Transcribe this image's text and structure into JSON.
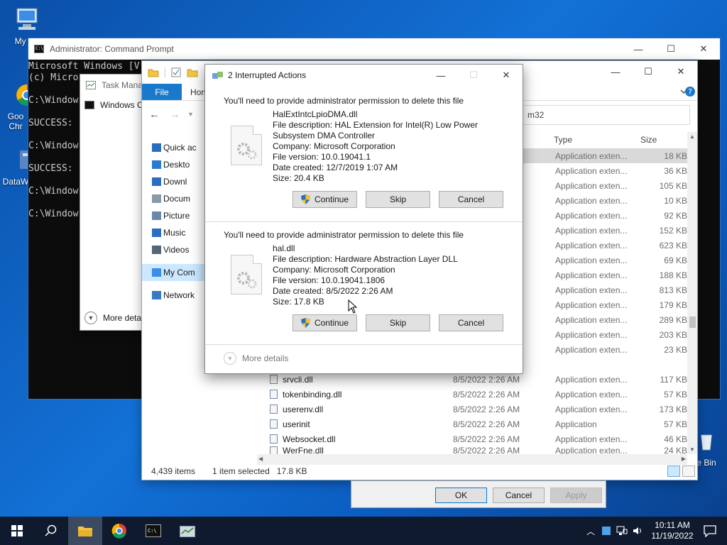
{
  "desktop": {
    "icons": [
      {
        "label": "My Co"
      },
      {
        "label": "Goo Chr"
      },
      {
        "label": "DataW"
      },
      {
        "label": "e Bin"
      }
    ]
  },
  "cmd": {
    "title": "Administrator: Command Prompt",
    "lines": [
      "Microsoft Windows [V",
      "(c) Micros",
      "",
      "C:\\Window",
      "",
      "SUCCESS:",
      "",
      "C:\\Window",
      "",
      "SUCCESS:",
      "",
      "C:\\Window",
      "",
      "C:\\Window"
    ]
  },
  "taskmgr": {
    "title": "Task Manag",
    "row": "Windows C",
    "more": "More deta"
  },
  "explorer": {
    "tabs": {
      "file": "File",
      "home": "Hom"
    },
    "address": "m32",
    "columns": {
      "type": "Type",
      "size": "Size"
    },
    "nav": [
      {
        "label": "Quick ac",
        "icon": "star-icon"
      },
      {
        "label": "Deskto",
        "icon": "desktop-icon"
      },
      {
        "label": "Downl",
        "icon": "download-icon"
      },
      {
        "label": "Docum",
        "icon": "document-icon"
      },
      {
        "label": "Picture",
        "icon": "picture-icon"
      },
      {
        "label": "Music",
        "icon": "music-icon"
      },
      {
        "label": "Videos",
        "icon": "video-icon"
      },
      {
        "label": "My Com",
        "icon": "computer-icon"
      },
      {
        "label": "Network",
        "icon": "network-icon"
      }
    ],
    "rows_partial": [
      {
        "type": "Application exten...",
        "size": "18 KB"
      },
      {
        "type": "Application exten...",
        "size": "36 KB"
      },
      {
        "type": "Application exten...",
        "size": "105 KB"
      },
      {
        "type": "Application exten...",
        "size": "10 KB"
      },
      {
        "type": "Application exten...",
        "size": "92 KB"
      },
      {
        "type": "Application exten...",
        "size": "152 KB"
      },
      {
        "type": "Application exten...",
        "size": "623 KB"
      },
      {
        "type": "Application exten...",
        "size": "69 KB"
      },
      {
        "type": "Application exten...",
        "size": "188 KB"
      },
      {
        "type": "Application exten...",
        "size": "813 KB"
      },
      {
        "type": "Application exten...",
        "size": "179 KB"
      },
      {
        "type": "Application exten...",
        "size": "289 KB"
      },
      {
        "type": "Application exten...",
        "size": "203 KB"
      },
      {
        "type": "Application exten...",
        "size": "23 KB"
      }
    ],
    "rows_full": [
      {
        "name": "srvcli.dll",
        "date": "8/5/2022 2:26 AM",
        "type": "Application exten...",
        "size": "117 KB"
      },
      {
        "name": "tokenbinding.dll",
        "date": "8/5/2022 2:26 AM",
        "type": "Application exten...",
        "size": "57 KB"
      },
      {
        "name": "userenv.dll",
        "date": "8/5/2022 2:26 AM",
        "type": "Application exten...",
        "size": "173 KB"
      },
      {
        "name": "userinit",
        "date": "8/5/2022 2:26 AM",
        "type": "Application",
        "size": "57 KB"
      },
      {
        "name": "Websocket.dll",
        "date": "8/5/2022 2:26 AM",
        "type": "Application exten...",
        "size": "46 KB"
      },
      {
        "name": "WerFne.dll",
        "date": "8/5/2022 2:26 AM",
        "type": "Application exten...",
        "size": "24 KB"
      }
    ],
    "status": {
      "items": "4,439 items",
      "selected": "1 item selected",
      "size": "17.8 KB"
    }
  },
  "properties": {
    "ok": "OK",
    "cancel": "Cancel",
    "apply": "Apply"
  },
  "dialog": {
    "title": "2 Interrupted Actions",
    "items": [
      {
        "heading": "You'll need to provide administrator permission to delete this file",
        "name": "HalExtIntcLpioDMA.dll",
        "desc1": "File description: HAL Extension for Intel(R) Low Power",
        "desc2": "Subsystem DMA Controller",
        "company": "Company: Microsoft Corporation",
        "version": "File version: 10.0.19041.1",
        "created": "Date created: 12/7/2019 1:07 AM",
        "size": "Size: 20.4 KB"
      },
      {
        "heading": "You'll need to provide administrator permission to delete this file",
        "name": "hal.dll",
        "desc1": "File description: Hardware Abstraction Layer DLL",
        "company": "Company: Microsoft Corporation",
        "version": "File version: 10.0.19041.1806",
        "created": "Date created: 8/5/2022 2:26 AM",
        "size": "Size: 17.8 KB"
      }
    ],
    "buttons": {
      "continue": "Continue",
      "skip": "Skip",
      "cancel": "Cancel"
    },
    "more_details": "More details"
  },
  "taskbar": {
    "time": "10:11 AM",
    "date": "11/19/2022"
  },
  "colors": {
    "accent": "#1979ca",
    "selection": "#cce8ff",
    "taskbar": "#0f1a2e"
  }
}
